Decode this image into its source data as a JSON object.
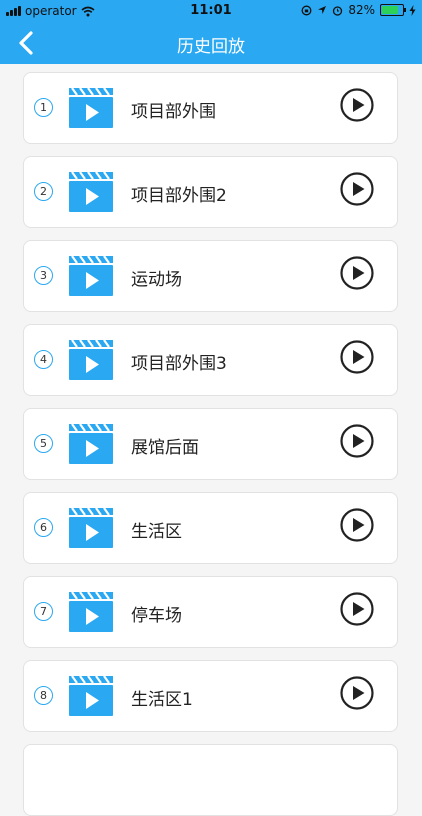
{
  "status_bar": {
    "carrier": "operator",
    "time": "11:01",
    "battery_percent": "82%",
    "battery_level": 0.82,
    "icons": [
      "signal-icon",
      "wifi-icon",
      "orientation-lock-icon",
      "location-icon",
      "alarm-icon",
      "charging-icon"
    ]
  },
  "nav": {
    "title": "历史回放",
    "back_icon": "chevron-left-icon"
  },
  "colors": {
    "accent": "#2aa8f2",
    "card_border": "#e2e2e2",
    "background": "#f5f5f5",
    "battery_fill": "#2bd158"
  },
  "items": [
    {
      "index": "1",
      "label": "项目部外围"
    },
    {
      "index": "2",
      "label": "项目部外围2"
    },
    {
      "index": "3",
      "label": "运动场"
    },
    {
      "index": "4",
      "label": "项目部外围3"
    },
    {
      "index": "5",
      "label": "展馆后面"
    },
    {
      "index": "6",
      "label": "生活区"
    },
    {
      "index": "7",
      "label": "停车场"
    },
    {
      "index": "8",
      "label": "生活区1"
    }
  ]
}
